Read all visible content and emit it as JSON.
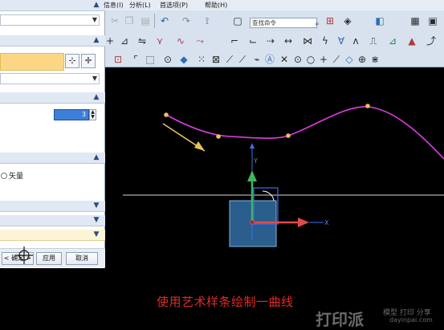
{
  "dialog": {
    "option_label": "矢量",
    "number_value": "3",
    "buttons": {
      "ok": "< 确定 >",
      "apply": "应用",
      "cancel": "取消"
    }
  },
  "menu": {
    "items": [
      "信息(I)",
      "分析(L)",
      "首选项(P)",
      "帮助(H)"
    ]
  },
  "toolbar": {
    "search_placeholder": "查找命令"
  },
  "canvas": {
    "axis_labels": {
      "y": "Y",
      "x": "X"
    },
    "caption": "使用艺术样条绘制一曲线",
    "curve_color": "#e23be6",
    "point_color": "#e8c25c",
    "background": "#000000"
  },
  "watermark": {
    "brand": "打印派",
    "tagline": "模型 打印 分享",
    "url": "dayinpai.com"
  }
}
